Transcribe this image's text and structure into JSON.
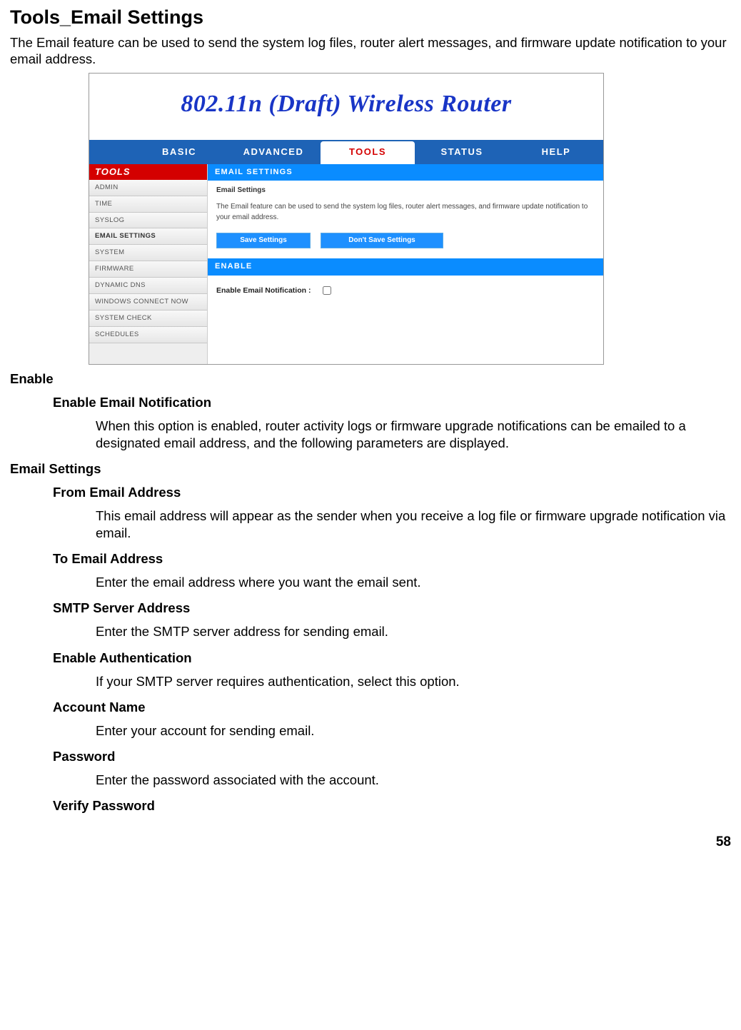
{
  "page": {
    "title": "Tools_Email Settings",
    "intro": "The Email feature can be used to send the system log files, router alert messages, and firmware update notification to your email address.",
    "number": "58"
  },
  "screenshot": {
    "banner": "802.11n (Draft) Wireless Router",
    "topnav": [
      "BASIC",
      "ADVANCED",
      "TOOLS",
      "STATUS",
      "HELP"
    ],
    "topnav_active": "TOOLS",
    "side_head": "TOOLS",
    "side_items": [
      "ADMIN",
      "TIME",
      "SYSLOG",
      "EMAIL SETTINGS",
      "SYSTEM",
      "FIRMWARE",
      "DYNAMIC DNS",
      "WINDOWS CONNECT NOW",
      "SYSTEM CHECK",
      "SCHEDULES"
    ],
    "side_selected": "EMAIL SETTINGS",
    "panel1_head": "EMAIL SETTINGS",
    "panel1_sub": "Email Settings",
    "panel1_desc": "The Email feature can be used to send the system log files, router alert messages, and firmware update notification to your email address.",
    "btn_save": "Save Settings",
    "btn_dont": "Don't Save Settings",
    "panel2_head": "ENABLE",
    "enable_label": "Enable Email Notification :"
  },
  "doc": {
    "enable_h": "Enable",
    "enable_sub_h": "Enable Email Notification",
    "enable_sub_p": "When this option is enabled, router activity logs or firmware upgrade notifications can be emailed to a designated email address, and the following parameters are displayed.",
    "email_h": "Email Settings",
    "from_h": "From Email Address",
    "from_p": "This email address will appear as the sender when you receive a log file or firmware upgrade notification via email.",
    "to_h": "To Email Address",
    "to_p": "Enter the email address where you want the email sent.",
    "smtp_h": "SMTP Server Address",
    "smtp_p": "Enter the SMTP server address for sending email.",
    "auth_h": "Enable Authentication",
    "auth_p": "If your SMTP server requires authentication, select this option.",
    "acct_h": "Account Name",
    "acct_p": "Enter your account for sending email.",
    "pwd_h": "Password",
    "pwd_p": "Enter the password associated with the account.",
    "vpwd_h": "Verify Password"
  }
}
